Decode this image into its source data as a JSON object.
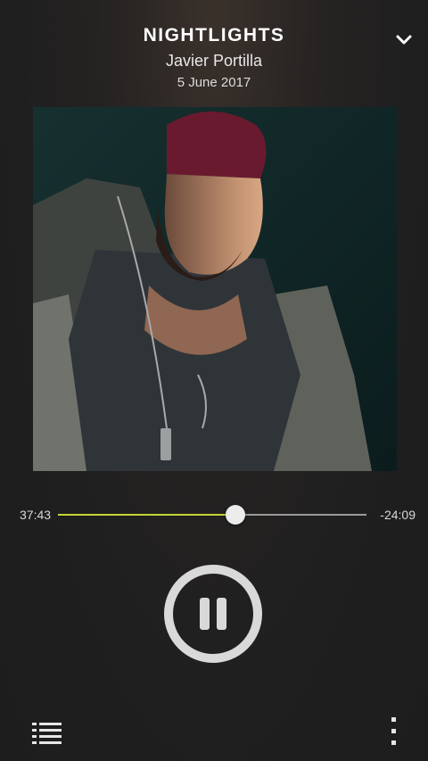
{
  "track": {
    "title": "NIGHTLIGHTS",
    "artist": "Javier Portilla",
    "date": "5 June 2017"
  },
  "player": {
    "elapsed": "37:43",
    "remaining": "-24:09",
    "progress_fraction": 0.575,
    "state": "playing"
  },
  "icons": {
    "collapse": "chevron-down-icon",
    "pause": "pause-icon",
    "queue": "queue-list-icon",
    "more": "more-vertical-icon"
  },
  "colors": {
    "accent": "#c6d437",
    "track": "#9a9a9a",
    "thumb": "#ececec",
    "control": "#d9d9d9"
  }
}
